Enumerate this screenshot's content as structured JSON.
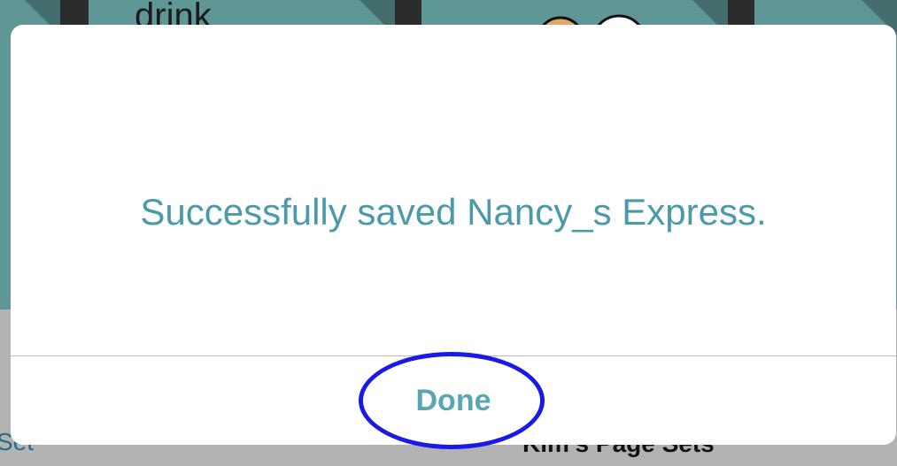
{
  "background": {
    "tile_word": "drink",
    "bottom_left_label": "Set",
    "bottom_right_label": "Kim's Page Sets"
  },
  "alert": {
    "message": "Successfully saved Nancy_s Express.",
    "button_label": "Done"
  },
  "colors": {
    "tile": "#5f9696",
    "message_text": "#4b9aaa",
    "button_text": "#5aa6b3",
    "highlight": "#1a1ae6"
  }
}
